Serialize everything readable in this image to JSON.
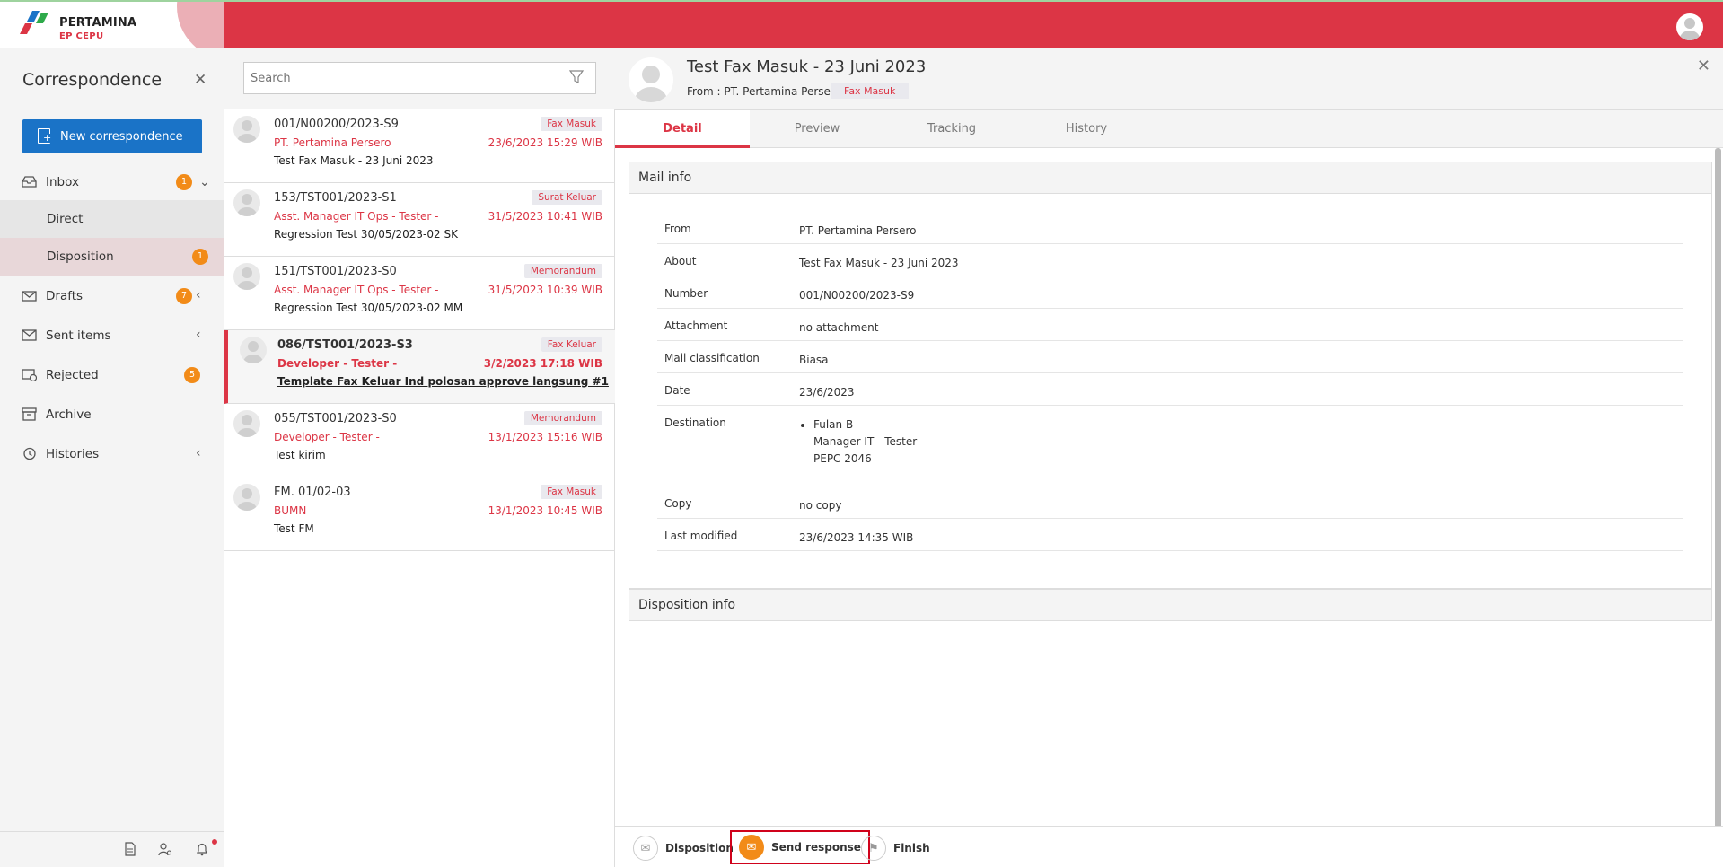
{
  "brand": {
    "name": "PERTAMINA",
    "sub": "EP CEPU"
  },
  "sidebar": {
    "title": "Correspondence",
    "new_button": "New correspondence",
    "items": [
      {
        "label": "Inbox",
        "badge": "1"
      },
      {
        "label": "Direct"
      },
      {
        "label": "Disposition",
        "badge": "1"
      },
      {
        "label": "Drafts",
        "badge": "7"
      },
      {
        "label": "Sent items"
      },
      {
        "label": "Rejected",
        "badge": "5"
      },
      {
        "label": "Archive"
      },
      {
        "label": "Histories"
      }
    ]
  },
  "search": {
    "placeholder": "Search"
  },
  "mails": [
    {
      "number": "001/N00200/2023-S9",
      "sender": "PT. Pertamina Persero",
      "subject": "Test Fax Masuk - 23 Juni 2023",
      "tag": "Fax Masuk",
      "date": "23/6/2023 15:29 WIB"
    },
    {
      "number": "153/TST001/2023-S1",
      "sender": "Asst. Manager IT Ops - Tester -",
      "subject": "Regression Test 30/05/2023-02 SK",
      "tag": "Surat Keluar",
      "date": "31/5/2023 10:41 WIB"
    },
    {
      "number": "151/TST001/2023-S0",
      "sender": "Asst. Manager IT Ops - Tester -",
      "subject": "Regression Test 30/05/2023-02 MM",
      "tag": "Memorandum",
      "date": "31/5/2023 10:39 WIB"
    },
    {
      "number": "086/TST001/2023-S3",
      "sender": "Developer - Tester -",
      "subject": "Template Fax Keluar Ind polosan approve langsung #1",
      "tag": "Fax Keluar",
      "date": "3/2/2023 17:18 WIB"
    },
    {
      "number": "055/TST001/2023-S0",
      "sender": "Developer - Tester -",
      "subject": "Test kirim",
      "tag": "Memorandum",
      "date": "13/1/2023 15:16 WIB"
    },
    {
      "number": "FM. 01/02-03",
      "sender": "BUMN",
      "subject": "Test FM",
      "tag": "Fax Masuk",
      "date": "13/1/2023 10:45 WIB"
    }
  ],
  "detail": {
    "title": "Test Fax Masuk - 23 Juni 2023",
    "from": "From : PT. Pertamina Persero",
    "tag": "Fax Masuk",
    "tabs": [
      "Detail",
      "Preview",
      "Tracking",
      "History"
    ],
    "mail_info_title": "Mail info",
    "disposition_info_title": "Disposition info",
    "fields": {
      "from_label": "From",
      "from": "PT. Pertamina Persero",
      "about_label": "About",
      "about": "Test Fax Masuk - 23 Juni 2023",
      "number_label": "Number",
      "number": "001/N00200/2023-S9",
      "attachment_label": "Attachment",
      "attachment": "no attachment",
      "classification_label": "Mail classification",
      "classification": "Biasa",
      "date_label": "Date",
      "date": "23/6/2023",
      "destination_label": "Destination",
      "destination_name": "Fulan B",
      "destination_role": "Manager IT - Tester",
      "destination_code": "PEPC 2046",
      "copy_label": "Copy",
      "copy": "no copy",
      "modified_label": "Last modified",
      "modified": "23/6/2023 14:35 WIB"
    },
    "actions": {
      "disposition": "Disposition",
      "send_response": "Send response",
      "finish": "Finish"
    }
  }
}
